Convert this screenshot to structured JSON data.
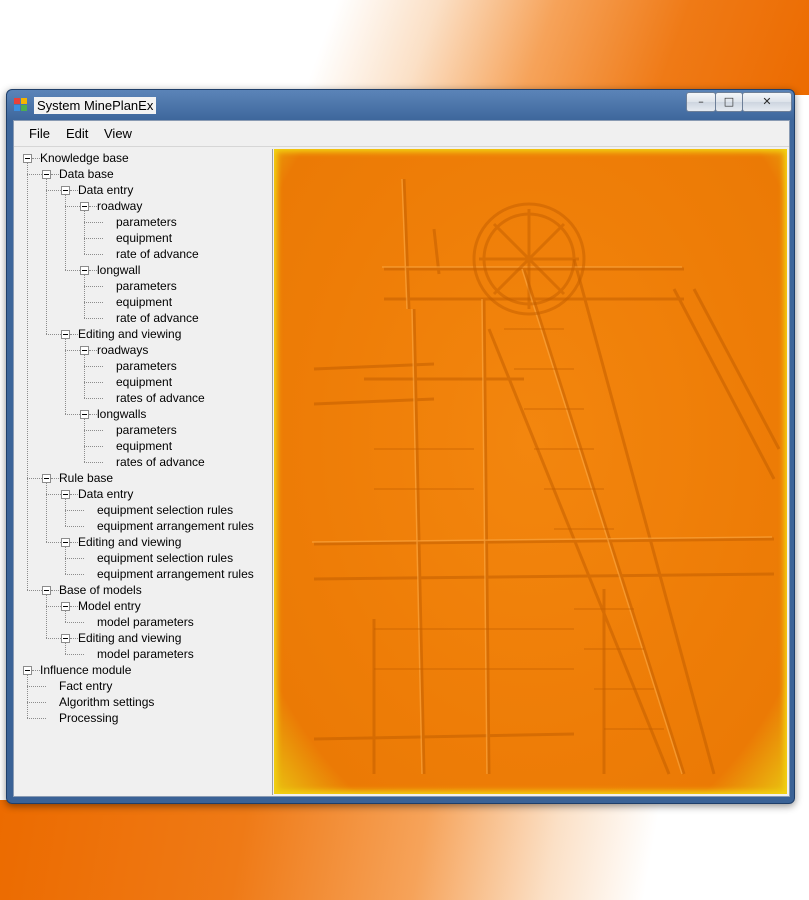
{
  "window": {
    "title": "System MinePlanEx"
  },
  "controls": {
    "minimize": "–",
    "maximize": "□",
    "close": "✕"
  },
  "menu": [
    "File",
    "Edit",
    "View"
  ],
  "tree": [
    {
      "label": "Knowledge base",
      "level": 0,
      "expander": true
    },
    {
      "label": "Data base",
      "level": 1,
      "expander": true
    },
    {
      "label": "Data entry",
      "level": 2,
      "expander": true
    },
    {
      "label": "roadway",
      "level": 3,
      "expander": true
    },
    {
      "label": "parameters",
      "level": 4,
      "expander": false
    },
    {
      "label": "equipment",
      "level": 4,
      "expander": false
    },
    {
      "label": "rate of advance",
      "level": 4,
      "expander": false
    },
    {
      "label": "longwall",
      "level": 3,
      "expander": true
    },
    {
      "label": "parameters",
      "level": 4,
      "expander": false
    },
    {
      "label": "equipment",
      "level": 4,
      "expander": false
    },
    {
      "label": "rate of advance",
      "level": 4,
      "expander": false
    },
    {
      "label": "Editing and viewing",
      "level": 2,
      "expander": true
    },
    {
      "label": "roadways",
      "level": 3,
      "expander": true
    },
    {
      "label": "parameters",
      "level": 4,
      "expander": false
    },
    {
      "label": "equipment",
      "level": 4,
      "expander": false
    },
    {
      "label": "rates of advance",
      "level": 4,
      "expander": false
    },
    {
      "label": "longwalls",
      "level": 3,
      "expander": true
    },
    {
      "label": "parameters",
      "level": 4,
      "expander": false
    },
    {
      "label": "equipment",
      "level": 4,
      "expander": false
    },
    {
      "label": "rates of advance",
      "level": 4,
      "expander": false
    },
    {
      "label": "Rule base",
      "level": 1,
      "expander": true
    },
    {
      "label": "Data entry",
      "level": 2,
      "expander": true
    },
    {
      "label": "equipment selection rules",
      "level": 3,
      "expander": false
    },
    {
      "label": "equipment arrangement rules",
      "level": 3,
      "expander": false
    },
    {
      "label": "Editing and viewing",
      "level": 2,
      "expander": true
    },
    {
      "label": "equipment selection rules",
      "level": 3,
      "expander": false
    },
    {
      "label": "equipment arrangement rules",
      "level": 3,
      "expander": false
    },
    {
      "label": "Base of models",
      "level": 1,
      "expander": true
    },
    {
      "label": "Model entry",
      "level": 2,
      "expander": true
    },
    {
      "label": "model parameters",
      "level": 3,
      "expander": false
    },
    {
      "label": "Editing and viewing",
      "level": 2,
      "expander": true
    },
    {
      "label": "model parameters",
      "level": 3,
      "expander": false
    },
    {
      "label": "Influence module",
      "level": 0,
      "expander": true
    },
    {
      "label": "Fact entry",
      "level": 1,
      "expander": false
    },
    {
      "label": "Algorithm settings",
      "level": 1,
      "expander": false
    },
    {
      "label": "Processing",
      "level": 1,
      "expander": false
    }
  ],
  "image": {
    "subject": "mine headframe embossed picture",
    "tint": "#ee7d07"
  }
}
